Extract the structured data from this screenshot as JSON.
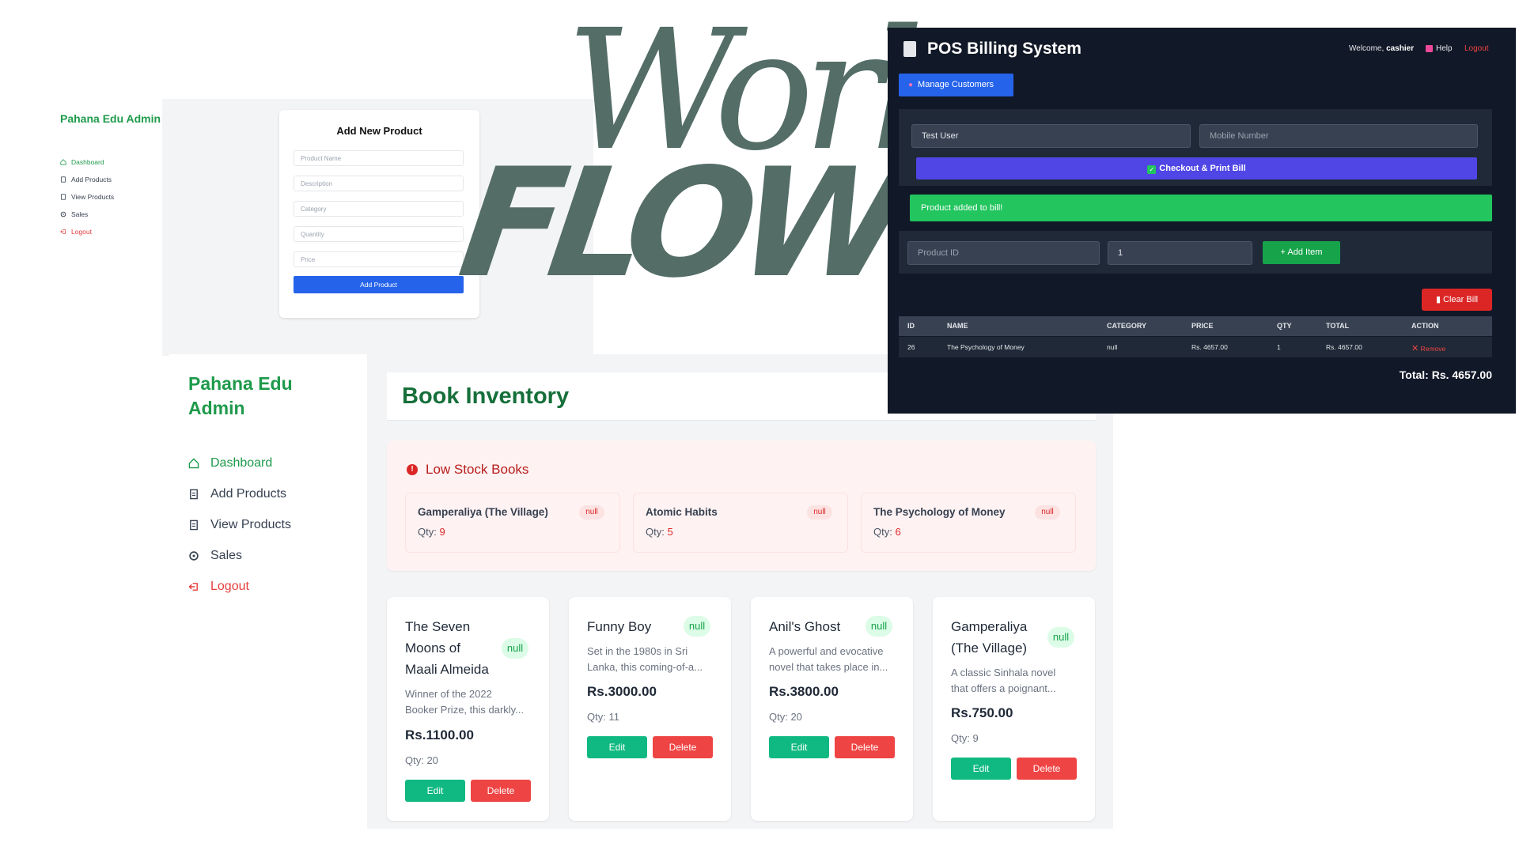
{
  "small_screen": {
    "brand": "Pahana Edu Admin",
    "nav": [
      {
        "label": "Dashboard",
        "icon": "home-icon"
      },
      {
        "label": "Add Products",
        "icon": "document-icon"
      },
      {
        "label": "View Products",
        "icon": "document-icon"
      },
      {
        "label": "Sales",
        "icon": "gear-icon"
      },
      {
        "label": "Logout",
        "icon": "logout-icon"
      }
    ],
    "form": {
      "title": "Add New Product",
      "fields": [
        "Product Name",
        "Description",
        "Category",
        "Quantity",
        "Price"
      ],
      "submit": "Add Product"
    }
  },
  "headline": {
    "line1": "Work",
    "line2": "FLOW"
  },
  "pos": {
    "title": "POS Billing System",
    "welcome_prefix": "Welcome,",
    "user": "cashier",
    "help": "Help",
    "logout": "Logout",
    "manage_customers": "Manage Customers",
    "customer_name_value": "Test User",
    "mobile_placeholder": "Mobile Number",
    "checkout": "Checkout & Print Bill",
    "toast": "Product added to bill!",
    "product_id_placeholder": "Product ID",
    "qty_value": "1",
    "add_item": "Add Item",
    "clear_bill": "Clear Bill",
    "columns": [
      "ID",
      "NAME",
      "CATEGORY",
      "PRICE",
      "QTY",
      "TOTAL",
      "ACTION"
    ],
    "rows": [
      {
        "id": "26",
        "name": "The Psychology of Money",
        "category": "null",
        "price": "Rs. 4657.00",
        "qty": "1",
        "total": "Rs. 4657.00",
        "action": "Remove"
      }
    ],
    "total": "Total: Rs. 4657.00"
  },
  "inventory": {
    "brand": "Pahana Edu Admin",
    "nav": [
      {
        "label": "Dashboard",
        "icon": "home-icon"
      },
      {
        "label": "Add Products",
        "icon": "document-icon"
      },
      {
        "label": "View Products",
        "icon": "document-icon"
      },
      {
        "label": "Sales",
        "icon": "gear-icon"
      },
      {
        "label": "Logout",
        "icon": "logout-icon"
      }
    ],
    "title": "Book Inventory",
    "low_stock": {
      "title": "Low Stock Books",
      "qty_label": "Qty:",
      "items": [
        {
          "name": "Gamperaliya (The Village)",
          "badge": "null",
          "qty": "9"
        },
        {
          "name": "Atomic Habits",
          "badge": "null",
          "qty": "5"
        },
        {
          "name": "The Psychology of Money",
          "badge": "null",
          "qty": "6"
        }
      ]
    },
    "books": [
      {
        "title_lines": [
          "The Seven",
          "Moons of",
          "Maali Almeida"
        ],
        "badge": "null",
        "desc_lines": [
          "Winner of the 2022",
          "Booker Prize, this darkly..."
        ],
        "price": "Rs.1100.00",
        "qty": "Qty: 20",
        "edit": "Edit",
        "delete": "Delete"
      },
      {
        "title_lines": [
          "Funny Boy"
        ],
        "badge": "null",
        "desc_lines": [
          "Set in the 1980s in Sri",
          "Lanka, this coming-of-a..."
        ],
        "price": "Rs.3000.00",
        "qty": "Qty: 11",
        "edit": "Edit",
        "delete": "Delete"
      },
      {
        "title_lines": [
          "Anil's Ghost"
        ],
        "badge": "null",
        "desc_lines": [
          "A powerful and evocative",
          "novel that takes place in..."
        ],
        "price": "Rs.3800.00",
        "qty": "Qty: 20",
        "edit": "Edit",
        "delete": "Delete"
      },
      {
        "title_lines": [
          "Gamperaliya",
          "(The Village)"
        ],
        "badge": "null",
        "desc_lines": [
          "A classic Sinhala novel",
          "that offers a poignant..."
        ],
        "price": "Rs.750.00",
        "qty": "Qty: 9",
        "edit": "Edit",
        "delete": "Delete"
      }
    ]
  }
}
